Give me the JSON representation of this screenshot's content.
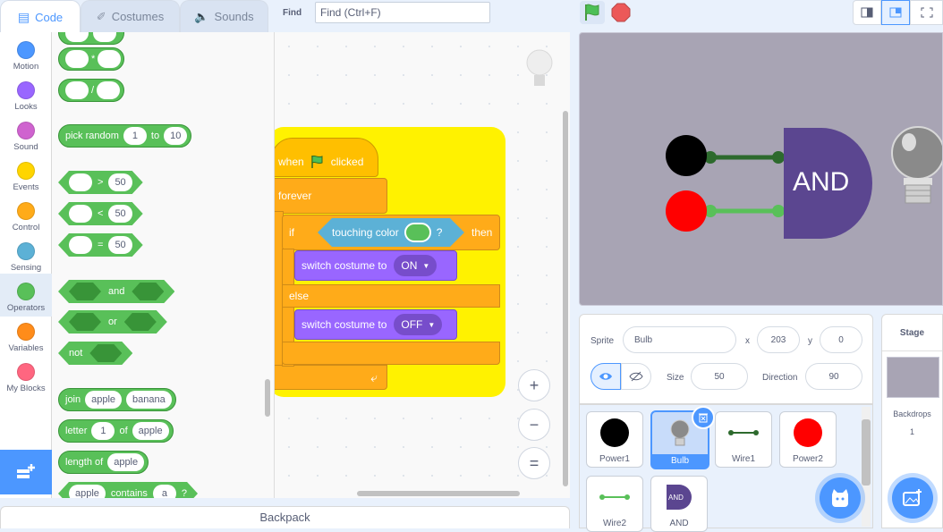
{
  "tabs": [
    {
      "label": "Code",
      "icon": "code-icon",
      "active": true
    },
    {
      "label": "Costumes",
      "icon": "brush-icon",
      "active": false
    },
    {
      "label": "Sounds",
      "icon": "speaker-icon",
      "active": false
    }
  ],
  "find": {
    "label": "Find",
    "placeholder": "Find (Ctrl+F)"
  },
  "categories": [
    {
      "label": "Motion",
      "color": "#4c97ff"
    },
    {
      "label": "Looks",
      "color": "#9966ff"
    },
    {
      "label": "Sound",
      "color": "#cf63cf"
    },
    {
      "label": "Events",
      "color": "#ffd500"
    },
    {
      "label": "Control",
      "color": "#ffab19"
    },
    {
      "label": "Sensing",
      "color": "#5cb1d6"
    },
    {
      "label": "Operators",
      "color": "#59c059",
      "selected": true
    },
    {
      "label": "Variables",
      "color": "#ff8c1a"
    },
    {
      "label": "My Blocks",
      "color": "#ff6680"
    }
  ],
  "palette": {
    "mul_op": "*",
    "div_op": "/",
    "pick_random": {
      "label": "pick random",
      "from": "1",
      "to_label": "to",
      "to": "10"
    },
    "gt": {
      "op": ">",
      "value": "50"
    },
    "lt": {
      "op": "<",
      "value": "50"
    },
    "eq": {
      "op": "=",
      "value": "50"
    },
    "and_label": "and",
    "or_label": "or",
    "not_label": "not",
    "join": {
      "label": "join",
      "a": "apple",
      "b": "banana"
    },
    "letter": {
      "label": "letter",
      "n": "1",
      "of": "of",
      "s": "apple"
    },
    "length": {
      "label": "length of",
      "s": "apple"
    },
    "contains": {
      "a": "apple",
      "label": "contains",
      "b": "a",
      "q": "?"
    }
  },
  "script": {
    "when": "when",
    "clicked": "clicked",
    "forever": "forever",
    "if": "if",
    "touching": "touching color",
    "question": "?",
    "then": "then",
    "switch1": "switch costume to",
    "on": "ON",
    "else": "else",
    "switch2": "switch costume to",
    "off": "OFF",
    "zoom_in": "+",
    "zoom_out": "−",
    "reset": "="
  },
  "backpack": "Backpack",
  "stage": {
    "and_label": "AND",
    "power1_color": "#000000",
    "power2_color": "#ff0000",
    "wire1_color": "#2d6a2d",
    "wire2_color": "#59c059",
    "gate_color": "#5b4690"
  },
  "sprite_info": {
    "sprite_label": "Sprite",
    "sprite_name": "Bulb",
    "x_label": "x",
    "x": "203",
    "y_label": "y",
    "y": "0",
    "size_label": "Size",
    "size": "50",
    "direction_label": "Direction",
    "direction": "90"
  },
  "sprites": [
    {
      "name": "Power1"
    },
    {
      "name": "Bulb",
      "selected": true
    },
    {
      "name": "Wire1"
    },
    {
      "name": "Power2"
    },
    {
      "name": "Wire2"
    },
    {
      "name": "AND"
    }
  ],
  "stage_panel": {
    "title": "Stage",
    "backdrops_label": "Backdrops",
    "backdrops_count": "1"
  }
}
